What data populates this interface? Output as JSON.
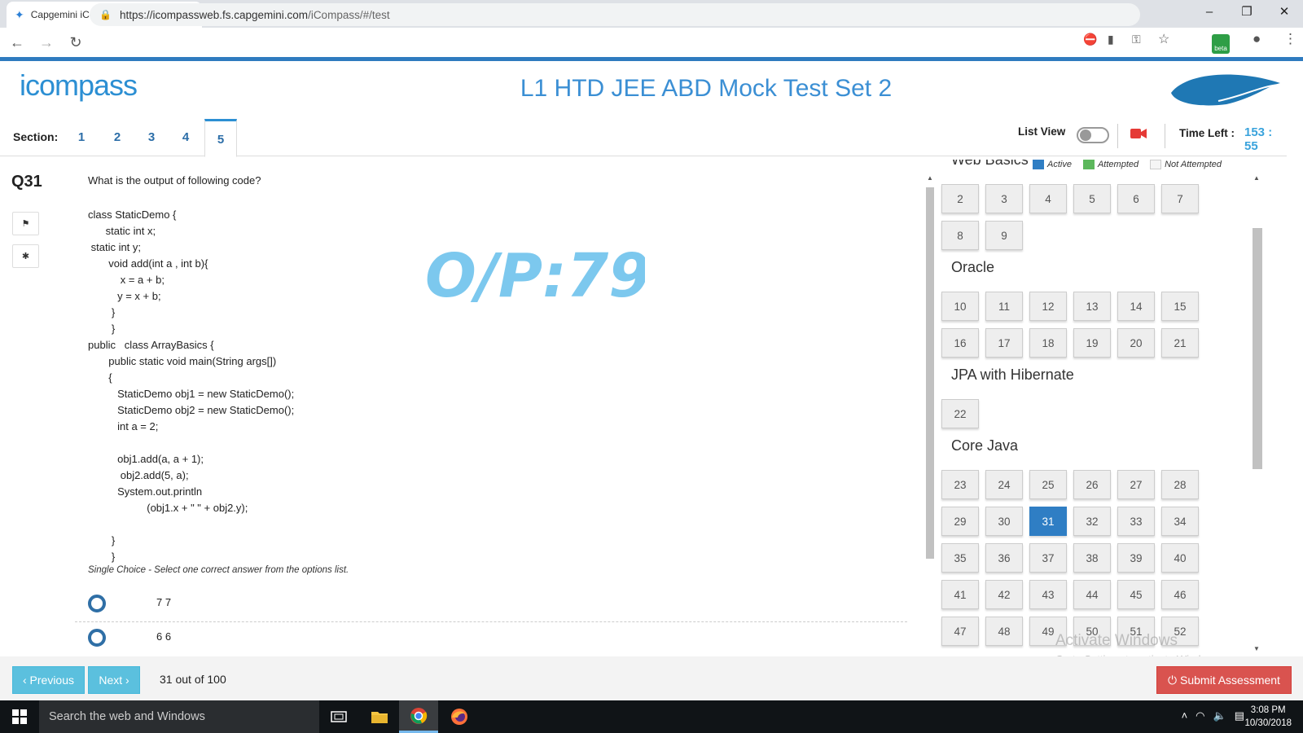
{
  "browser": {
    "tab_title": "Capgemini iCompass - Comp",
    "url_host": "https://icompassweb.fs.capgemini.com",
    "url_path": "/iCompass/#/test",
    "beta_badge": "beta",
    "window_controls": [
      "–",
      "❐",
      "✕"
    ]
  },
  "header": {
    "logo_text": "icompass",
    "test_title": "L1 HTD JEE ABD Mock Test Set 2"
  },
  "sections": {
    "label": "Section:",
    "tabs": [
      "1",
      "2",
      "3",
      "4",
      "5"
    ],
    "active_tab": "5"
  },
  "toolbar": {
    "list_view_label": "List View",
    "time_left_label": "Time Left :",
    "time_left_value": "153 : 55"
  },
  "question": {
    "number": "Q31",
    "prompt": "What is the output of following code?",
    "code": "class StaticDemo {\n      static int x;\n static int y;\n       void add(int a , int b){\n           x = a + b;\n          y = x + b;\n        }\n        }\npublic   class ArrayBasics {\n       public static void main(String args[])\n       {\n          StaticDemo obj1 = new StaticDemo();\n          StaticDemo obj2 = new StaticDemo();\n          int a = 2;\n\n          obj1.add(a, a + 1);\n           obj2.add(5, a);\n          System.out.println\n                    (obj1.x + \" \" + obj2.y);\n\n        }\n        }",
    "annotation": "O/P:79",
    "hint": "Single Choice - Select one correct answer from the options list.",
    "options": [
      "7 7",
      "6 6"
    ]
  },
  "legend": {
    "active": "Active",
    "attempted": "Attempted",
    "not_attempted": "Not Attempted",
    "colors": {
      "active": "#2f7ec4",
      "attempted": "#5cb85c",
      "not_attempted": "#f5f5f5"
    }
  },
  "palette": {
    "groups": [
      {
        "title": "Web Basics",
        "questions": [
          "2",
          "3",
          "4",
          "5",
          "6",
          "7",
          "8",
          "9"
        ]
      },
      {
        "title": "Oracle",
        "questions": [
          "10",
          "11",
          "12",
          "13",
          "14",
          "15",
          "16",
          "17",
          "18",
          "19",
          "20",
          "21"
        ]
      },
      {
        "title": "JPA with Hibernate",
        "questions": [
          "22"
        ]
      },
      {
        "title": "Core Java",
        "questions": [
          "23",
          "24",
          "25",
          "26",
          "27",
          "28",
          "29",
          "30",
          "31",
          "32",
          "33",
          "34",
          "35",
          "36",
          "37",
          "38",
          "39",
          "40",
          "41",
          "42",
          "43",
          "44",
          "45",
          "46",
          "47",
          "48",
          "49",
          "50",
          "51",
          "52"
        ]
      }
    ],
    "active_question": "31"
  },
  "watermark": {
    "line1": "Activate Windows",
    "line2": "Go to Settings to activate Windows."
  },
  "footer": {
    "prev_label": "‹ Previous",
    "next_label": "Next ›",
    "progress_text": "31 out of 100",
    "submit_label": "⏻ Submit Assessment"
  },
  "taskbar": {
    "search_placeholder": "Search the web and Windows",
    "time": "3:08 PM",
    "date": "10/30/2018"
  }
}
